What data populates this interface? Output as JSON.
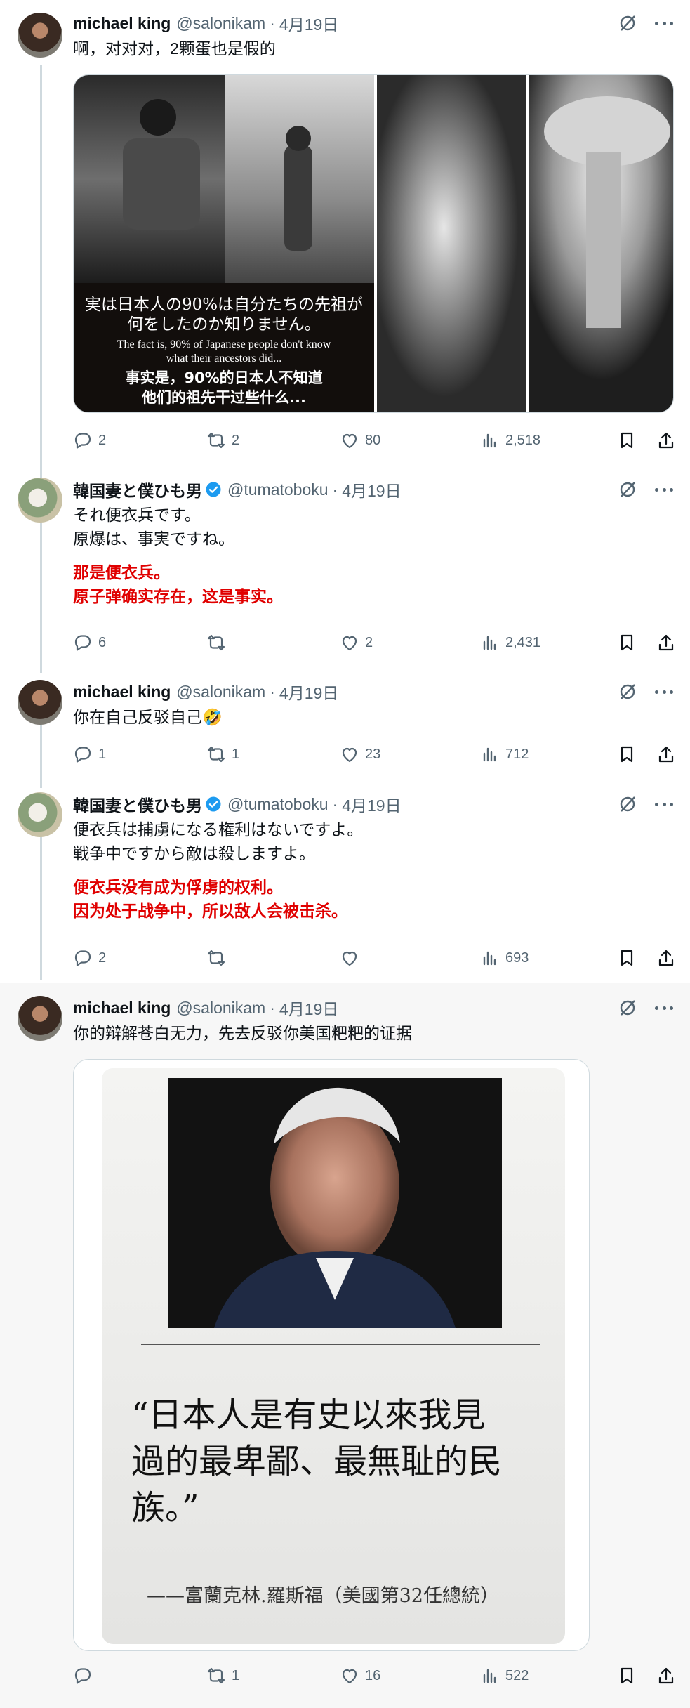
{
  "tweets": [
    {
      "author": "michael king",
      "handle": "@salonikam",
      "sep": "·",
      "date": "4月19日",
      "lines": [
        "啊，对对对，2颗蛋也是假的"
      ],
      "red_lines": [],
      "media": {
        "caption_jp_1": "実は日本人の90%は自分たちの先祖が",
        "caption_jp_2": "何をしたのか知りません。",
        "caption_en_1": "The fact is, 90% of Japanese people don't know",
        "caption_en_2": "what their ancestors did...",
        "caption_zh_1": "事实是，90%的日本人不知道",
        "caption_zh_2": "他们的祖先干过些什么..."
      },
      "stats": {
        "replies": "2",
        "reposts": "2",
        "likes": "80",
        "views": "2,518"
      }
    },
    {
      "author": "韓国妻と僕ひも男",
      "handle": "@tumatoboku",
      "sep": "·",
      "date": "4月19日",
      "lines": [
        "それ便衣兵です。",
        "原爆は、事実ですね。"
      ],
      "red_lines": [
        "那是便衣兵。",
        "原子弹确实存在，这是事实。"
      ],
      "stats": {
        "replies": "6",
        "reposts": "",
        "likes": "2",
        "views": "2,431"
      }
    },
    {
      "author": "michael king",
      "handle": "@salonikam",
      "sep": "·",
      "date": "4月19日",
      "lines": [
        "你在自己反驳自己🤣"
      ],
      "red_lines": [],
      "stats": {
        "replies": "1",
        "reposts": "1",
        "likes": "23",
        "views": "712"
      }
    },
    {
      "author": "韓国妻と僕ひも男",
      "handle": "@tumatoboku",
      "sep": "·",
      "date": "4月19日",
      "lines": [
        "便衣兵は捕虜になる権利はないですよ。",
        "戦争中ですから敵は殺しますよ。"
      ],
      "red_lines": [
        "便衣兵没有成为俘虏的权利。",
        "因为处于战争中，所以敌人会被击杀。"
      ],
      "stats": {
        "replies": "2",
        "reposts": "",
        "likes": "",
        "views": "693"
      }
    },
    {
      "author": "michael king",
      "handle": "@salonikam",
      "sep": "·",
      "date": "4月19日",
      "lines": [
        "你的辩解苍白无力，先去反驳你美国粑粑的证据"
      ],
      "red_lines": [],
      "media": {
        "quote_1": "“日本人是有史以來我見",
        "quote_2": "過的最卑鄙、最無耻的民",
        "quote_3": "族。”",
        "attribution": "——富蘭克林.羅斯福（美國第32任總統）"
      },
      "stats": {
        "replies": "",
        "reposts": "1",
        "likes": "16",
        "views": "522"
      }
    }
  ],
  "icons": {
    "top": [
      "grok-icon",
      "more-icon"
    ],
    "actions": [
      "reply-icon",
      "repost-icon",
      "like-icon",
      "views-icon",
      "bookmark-icon",
      "share-icon"
    ]
  },
  "colors": {
    "verified": "#1d9bf0",
    "red_text": "#e00000",
    "muted": "#536471",
    "thread_line": "#cfd9de",
    "highlight_bg": "#f7f7f7"
  }
}
